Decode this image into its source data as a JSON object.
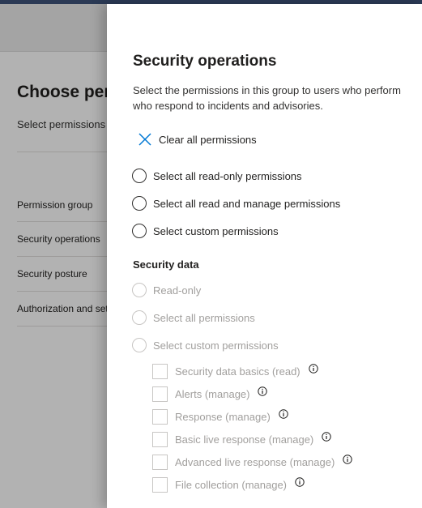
{
  "background": {
    "title": "Choose per",
    "subtitle": "Select permissions",
    "rows": [
      "Permission group",
      "Security operations",
      "Security posture",
      "Authorization and set"
    ]
  },
  "panel": {
    "title": "Security operations",
    "description_lines": [
      "Select the permissions in this group to users who perform",
      "who respond to incidents and advisories."
    ],
    "clear_label": "Clear all permissions",
    "options": [
      "Select all read-only permissions",
      "Select all read and manage permissions",
      "Select custom permissions"
    ],
    "security_data": {
      "title": "Security data",
      "options": [
        "Read-only",
        "Select all permissions",
        "Select custom permissions"
      ],
      "checkboxes": [
        "Security data basics (read)",
        "Alerts (manage)",
        "Response (manage)",
        "Basic live response (manage)",
        "Advanced live response (manage)",
        "File collection (manage)"
      ]
    }
  },
  "colors": {
    "accent": "#0078d4",
    "text": "#201f1e",
    "disabled_text": "#a19f9d",
    "overlay": "rgba(0,0,0,0.30)"
  },
  "icons": {
    "clear": "close-icon",
    "info": "info-icon"
  }
}
